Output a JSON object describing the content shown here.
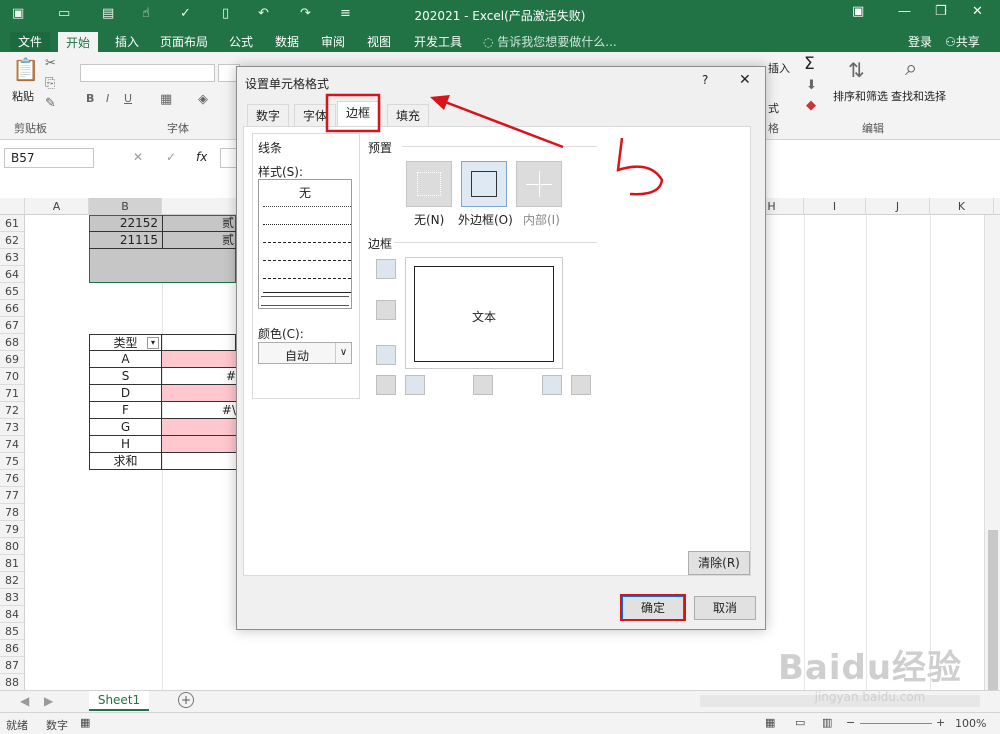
{
  "window": {
    "title": "202021 - Excel(产品激活失败)"
  },
  "ribbon": {
    "tabs": [
      "文件",
      "开始",
      "插入",
      "页面布局",
      "公式",
      "数据",
      "审阅",
      "视图",
      "开发工具"
    ],
    "tell_me": "告诉我您想要做什么...",
    "login": "登录",
    "share": "共享",
    "paste_label": "粘贴",
    "clipboard_label": "剪贴板",
    "font_label": "字体",
    "edit_label": "编辑",
    "sort_filter": "排序和筛选",
    "find_select": "查找和选择",
    "sigma": "Σ",
    "insert_partial": "插入",
    "format_partial": "式",
    "cells_partial": "格"
  },
  "formula_bar": {
    "name_box": "B57",
    "cancel": "✕",
    "enter": "✓",
    "fx": "fx"
  },
  "columns": [
    "A",
    "B",
    "H",
    "I",
    "J",
    "K"
  ],
  "rows": [
    "61",
    "62",
    "63",
    "64",
    "65",
    "66",
    "67",
    "68",
    "69",
    "70",
    "71",
    "72",
    "73",
    "74",
    "75",
    "76",
    "77",
    "78",
    "79",
    "80",
    "81",
    "82",
    "83",
    "84",
    "85",
    "86",
    "87",
    "88"
  ],
  "cells": {
    "r61b": "22152",
    "r61c": "贰",
    "r62b": "21115",
    "r62c": "贰",
    "r68b": "类型",
    "r69b": "A",
    "r70b": "S",
    "r70c": "#",
    "r71b": "D",
    "r72b": "F",
    "r72c": "#\\",
    "r73b": "G",
    "r74b": "H",
    "r75b": "求和"
  },
  "sheet_tabs": {
    "sheet1": "Sheet1",
    "add": "+"
  },
  "status": {
    "ready": "就绪",
    "numeric": "数字",
    "zoom": "100%"
  },
  "dialog": {
    "title": "设置单元格格式",
    "help": "?",
    "close": "✕",
    "tabs": [
      "数字",
      "字体",
      "边框",
      "填充"
    ],
    "line_group": "线条",
    "style_label": "样式(S):",
    "none_style": "无",
    "color_label": "颜色(C):",
    "color_value": "自动",
    "preset_group": "预置",
    "presets": [
      "无(N)",
      "外边框(O)",
      "内部(I)"
    ],
    "border_group": "边框",
    "preview_text": "文本",
    "clear_button": "清除(R)",
    "ok_button": "确定",
    "cancel_button": "取消"
  },
  "annotation": {
    "handwritten": "5",
    "color": "#d8141b"
  },
  "watermark": {
    "logo": "Baidu经验",
    "url": "jingyan.baidu.com"
  },
  "colors": {
    "excel_green": "#217346",
    "selection": "#c6c6c6",
    "pink_fill": "#ffc7ce",
    "accent_blue": "#0078d7"
  }
}
